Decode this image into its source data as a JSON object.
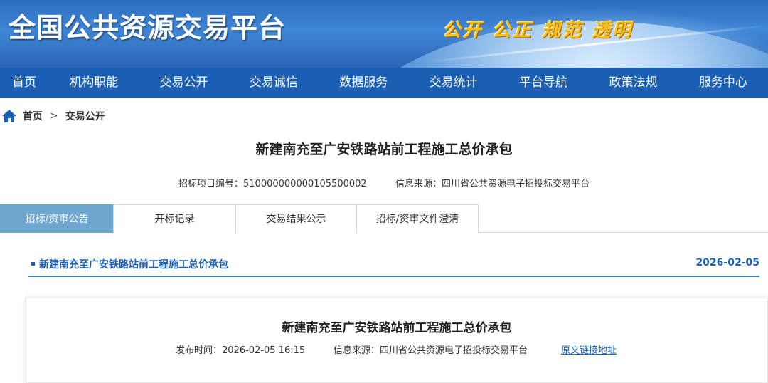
{
  "header": {
    "site_title": "全国公共资源交易平台",
    "slogan": "公开 公正 规范 透明"
  },
  "nav": {
    "items": [
      "首页",
      "机构职能",
      "交易公开",
      "交易诚信",
      "数据服务",
      "交易统计",
      "平台导航",
      "政策法规",
      "服务中心"
    ]
  },
  "breadcrumb": {
    "home": "首页",
    "separator": ">",
    "current": "交易公开"
  },
  "project": {
    "title": "新建南充至广安铁路站前工程施工总价承包",
    "code_label": "招标项目编号：",
    "code": "510000000000105500002",
    "source_label": "信息来源：",
    "source": "四川省公共资源电子招投标交易平台"
  },
  "tabs": [
    "招标/资审公告",
    "开标记录",
    "交易结果公示",
    "招标/资审文件澄清"
  ],
  "notice": {
    "title": "新建南充至广安铁路站前工程施工总价承包",
    "date": "2026-02-05"
  },
  "detail": {
    "title": "新建南充至广安铁路站前工程施工总价承包",
    "publish_label": "发布时间：",
    "publish_time": "2026-02-05 16:15",
    "source_label": "信息来源：",
    "source": "四川省公共资源电子招投标交易平台",
    "original_link": "原文链接地址"
  },
  "colors": {
    "nav_bg": "#1a5fb4",
    "active_tab": "#6fa6cf",
    "slogan": "#f6c21a",
    "link": "#1a5fb4"
  }
}
